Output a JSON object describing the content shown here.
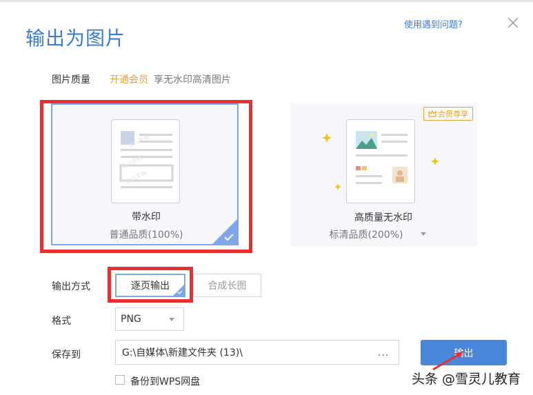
{
  "dialog": {
    "title": "输出为图片",
    "help_link": "使用遇到问题?"
  },
  "quality": {
    "label": "图片质量",
    "member_link": "开通会员",
    "member_desc": "享无水印高清图片",
    "options": [
      {
        "title": "带水印",
        "sub": "普通品质(100%)",
        "selected": true,
        "doc_watermark_text": "金山文档"
      },
      {
        "title": "高质量无水印",
        "sub": "标清品质(200%)",
        "selected": false,
        "badge": "会员尊享"
      }
    ]
  },
  "output_mode": {
    "label": "输出方式",
    "options": [
      "逐页输出",
      "合成长图"
    ],
    "selected": "逐页输出"
  },
  "format": {
    "label": "格式",
    "value": "PNG"
  },
  "save_to": {
    "label": "保存到",
    "path": "G:\\自媒体\\新建文件夹 (13)\\",
    "browse_label": "..."
  },
  "export_button": "输出",
  "backup": {
    "label": "备份到WPS网盘",
    "checked": false
  },
  "watermark": "头条 @雪灵儿教育",
  "colors": {
    "accent": "#4a86d9",
    "title": "#3a7bd5",
    "member": "#e8a23c",
    "highlight": "#e8302f"
  }
}
